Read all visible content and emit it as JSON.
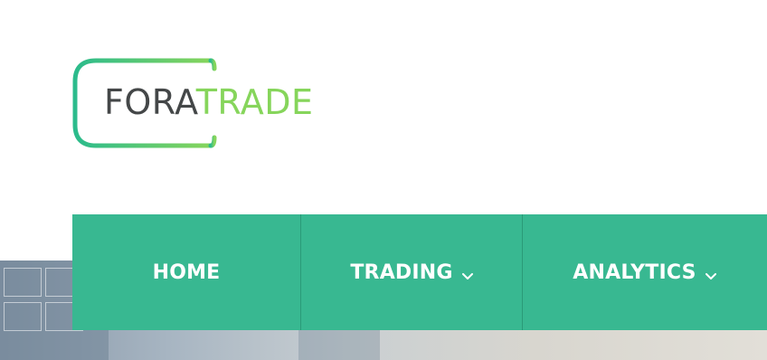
{
  "logo": {
    "part_a": "FORA",
    "part_b": "TRADE",
    "frame_gradient": [
      "#2bbb8c",
      "#86d55b"
    ]
  },
  "nav": {
    "background": "#38b891",
    "items": [
      {
        "label": "HOME",
        "has_dropdown": false
      },
      {
        "label": "TRADING",
        "has_dropdown": true,
        "icon": "chevron-down-icon"
      },
      {
        "label": "ANALYTICS",
        "has_dropdown": true,
        "icon": "chevron-down-icon"
      }
    ]
  }
}
